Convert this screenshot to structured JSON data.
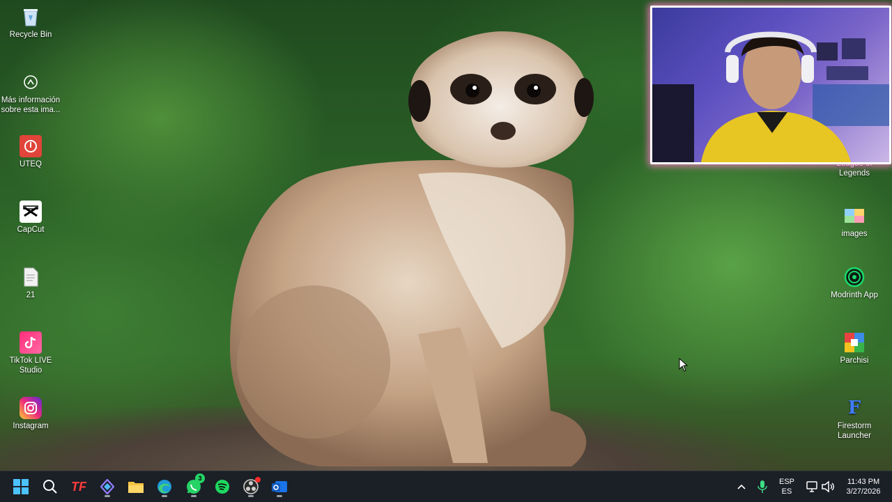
{
  "desktop": {
    "left_icons": [
      {
        "id": "recycle-bin",
        "label": "Recycle Bin",
        "icon": "recycle-bin-icon"
      },
      {
        "id": "more-info",
        "label": "Más información sobre esta ima...",
        "icon": "info-icon"
      },
      {
        "id": "uteq",
        "label": "UTEQ",
        "icon": "uteq-icon"
      },
      {
        "id": "capcut",
        "label": "CapCut",
        "icon": "capcut-icon"
      },
      {
        "id": "file-21",
        "label": "21",
        "icon": "text-file-icon"
      },
      {
        "id": "tiktok-live",
        "label": "TikTok LIVE Studio",
        "icon": "tiktok-icon"
      },
      {
        "id": "instagram",
        "label": "Instagram",
        "icon": "instagram-icon"
      }
    ],
    "right_icons": [
      {
        "id": "league",
        "label": "League of Legends",
        "icon": "league-icon"
      },
      {
        "id": "images",
        "label": "images",
        "icon": "image-file-icon"
      },
      {
        "id": "modrinth",
        "label": "Modrinth App",
        "icon": "modrinth-icon"
      },
      {
        "id": "parchisi",
        "label": "Parchisi",
        "icon": "parchisi-icon"
      },
      {
        "id": "firestorm",
        "label": "Firestorm Launcher",
        "icon": "firestorm-icon"
      }
    ]
  },
  "taskbar": {
    "apps": [
      {
        "name": "start-button",
        "icon": "windows-icon"
      },
      {
        "name": "search-button",
        "icon": "search-icon"
      },
      {
        "name": "tf-app-button",
        "icon": "tf-icon",
        "text": "TF"
      },
      {
        "name": "linear-app-button",
        "icon": "diamond-icon"
      },
      {
        "name": "file-explorer-button",
        "icon": "folder-icon"
      },
      {
        "name": "edge-button",
        "icon": "edge-icon"
      },
      {
        "name": "whatsapp-button",
        "icon": "whatsapp-icon",
        "badge": "3"
      },
      {
        "name": "spotify-button",
        "icon": "spotify-icon"
      },
      {
        "name": "obs-button",
        "icon": "obs-icon"
      },
      {
        "name": "outlook-button",
        "icon": "outlook-icon"
      }
    ],
    "tray": {
      "language_top": "ESP",
      "language_bottom": "ES",
      "time": "11:43 PM",
      "date": "3/27/2026"
    }
  },
  "colors": {
    "taskbar": "#1b1f26",
    "webcam_glow": "#ff78c8"
  }
}
